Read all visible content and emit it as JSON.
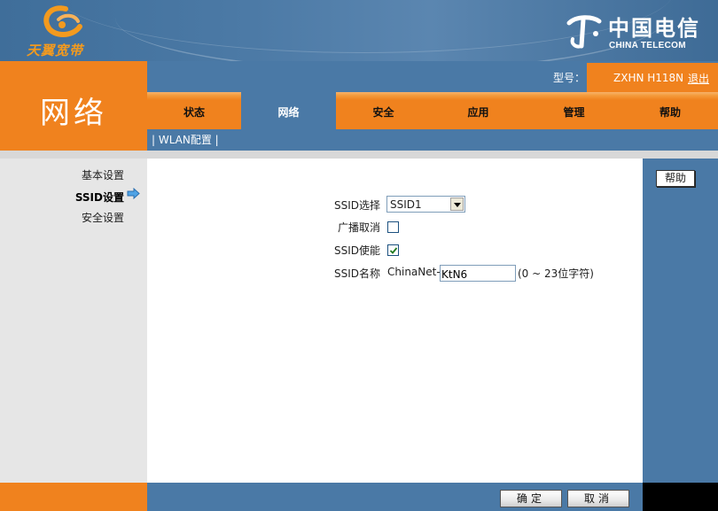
{
  "header": {
    "brand_left": "天翼宽带",
    "brand_right_cn": "中国电信",
    "brand_right_en": "CHINA TELECOM"
  },
  "section_title": "网络",
  "model": {
    "label": "型号：",
    "value": "ZXHN H118N",
    "logout": "退出"
  },
  "tabs": [
    {
      "label": "状态",
      "active": false
    },
    {
      "label": "网络",
      "active": true
    },
    {
      "label": "安全",
      "active": false
    },
    {
      "label": "应用",
      "active": false
    },
    {
      "label": "管理",
      "active": false
    },
    {
      "label": "帮助",
      "active": false
    }
  ],
  "subnav": "| WLAN配置 |",
  "sidebar": {
    "items": [
      {
        "label": "基本设置",
        "active": false
      },
      {
        "label": "SSID设置",
        "active": true
      },
      {
        "label": "安全设置",
        "active": false
      }
    ]
  },
  "form": {
    "ssid_select_label": "SSID选择",
    "ssid_select_value": "SSID1",
    "broadcast_cancel_label": "广播取消",
    "broadcast_cancel_checked": false,
    "ssid_enable_label": "SSID使能",
    "ssid_enable_checked": true,
    "ssid_name_label": "SSID名称",
    "ssid_name_prefix": "ChinaNet-",
    "ssid_name_value": "KtN6",
    "ssid_name_hint": "(0 ~ 23位字符)"
  },
  "help_button": "帮助",
  "buttons": {
    "confirm": "确定",
    "cancel": "取消"
  },
  "colors": {
    "orange": "#f0821e",
    "blue": "#4a79a6"
  }
}
